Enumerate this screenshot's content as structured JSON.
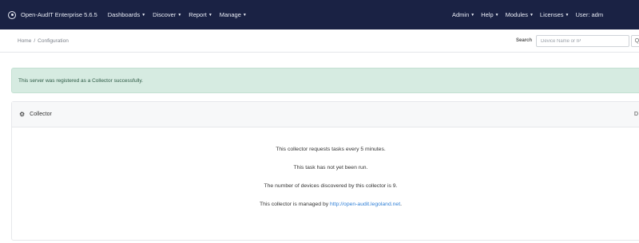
{
  "navbar": {
    "brand": "Open-AudIT Enterprise 5.6.5",
    "left_menu": [
      "Dashboards",
      "Discover",
      "Report",
      "Manage"
    ],
    "right_menu": [
      "Admin",
      "Help",
      "Modules",
      "Licenses",
      "User: adm"
    ]
  },
  "breadcrumb": {
    "home": "Home",
    "sep": "/",
    "current": "Configuration"
  },
  "search": {
    "label": "Search",
    "placeholder": "Device Name or IP",
    "button_glyph": "Q"
  },
  "alert": {
    "message": "This server was registered as a Collector successfully."
  },
  "panel": {
    "title": "Collector",
    "right_glyph": "D",
    "lines": [
      "This collector requests tasks every 5 minutes.",
      "This task has not yet been run.",
      "The number of devices discovered by this collector is 9."
    ],
    "managed_prefix": "This collector is managed by ",
    "managed_link": "http://open-audit.legoland.net",
    "managed_suffix": "."
  },
  "icons": {
    "logo": "open-audit-logo-icon",
    "caret": "caret-down-icon",
    "panel": "cogs-icon",
    "search": "search-icon"
  },
  "colors": {
    "navbar": "#1a2244",
    "alert_bg": "#d6ebe1",
    "link": "#2f7fd6"
  }
}
